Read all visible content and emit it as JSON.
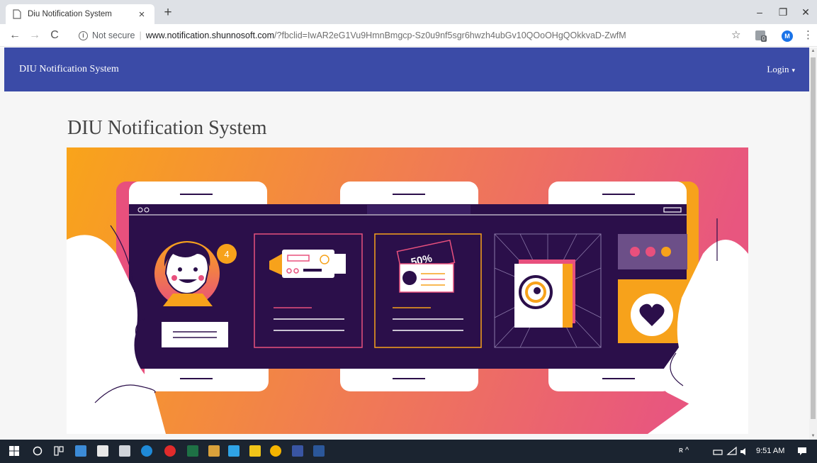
{
  "browser": {
    "tab_title": "Diu Notification System",
    "tab_close": "×",
    "new_tab": "+",
    "minimize": "–",
    "restore": "❐",
    "close": "✕",
    "back": "←",
    "forward": "→",
    "reload": "C",
    "info_glyph": "i",
    "security_label": "Not secure",
    "separator": "|",
    "url_host": "www.notification.shunnosoft.com",
    "url_rest": "/?fbclid=IwAR2eG1Vu9HmnBmgcp-Sz0u9nf5sgr6hwzh4ubGv10QOoOHgQOkkvaD-ZwfM",
    "bookmark_star": "☆",
    "extension_badge": "0",
    "profile_initial": "M",
    "menu": "⋮"
  },
  "page": {
    "navbar": {
      "brand": "DIU Notification System",
      "login_label": "Login",
      "login_caret": "▾"
    },
    "heading": "DIU Notification System",
    "hero": {
      "notification_count": "4",
      "ticket_text": "50%",
      "colors": {
        "gradient_start": "#f9a01b",
        "gradient_end": "#e8567f",
        "screen": "#2b0f4a",
        "accent_orange": "#f7a21b",
        "accent_pink": "#e8507d"
      }
    }
  },
  "taskbar": {
    "icons": [
      "windows-start-icon",
      "search-icon",
      "task-view-icon",
      "file-explorer-icon",
      "store-icon",
      "mail-icon",
      "edge-icon",
      "opera-icon",
      "excel-icon",
      "outlook-icon",
      "photoshop-icon",
      "notepad-icon",
      "chrome-icon",
      "visio-icon",
      "word-icon"
    ],
    "tray_text": "ʀ  ^",
    "clock": "9:51 AM"
  },
  "colors": {
    "navbar": "#3b4ba7",
    "taskbar": "#1b2430",
    "tabbar": "#dee1e6"
  }
}
